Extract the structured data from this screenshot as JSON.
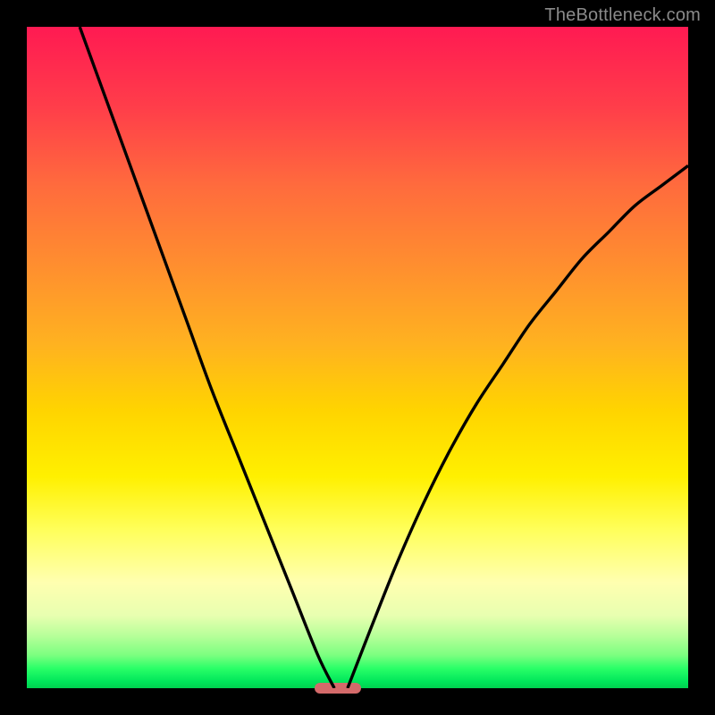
{
  "watermark": "TheBottleneck.com",
  "colors": {
    "frame": "#000000",
    "gradient_top": "#ff1a52",
    "gradient_mid": "#ffe800",
    "gradient_bottom": "#00d050",
    "curve": "#000000",
    "marker": "#d46a6a"
  },
  "chart_data": {
    "type": "line",
    "title": "",
    "xlabel": "",
    "ylabel": "",
    "xlim": [
      0,
      100
    ],
    "ylim": [
      0,
      100
    ],
    "grid": false,
    "marker_x_range": [
      43.5,
      50.5
    ],
    "series": [
      {
        "name": "left-curve",
        "x": [
          8,
          12,
          16,
          20,
          24,
          28,
          32,
          36,
          40,
          44,
          46.5
        ],
        "y": [
          100,
          89,
          78,
          67,
          56,
          45,
          35,
          25,
          15,
          5,
          0
        ]
      },
      {
        "name": "right-curve",
        "x": [
          48.5,
          52,
          56,
          60,
          64,
          68,
          72,
          76,
          80,
          84,
          88,
          92,
          96,
          100
        ],
        "y": [
          0,
          9,
          19,
          28,
          36,
          43,
          49,
          55,
          60,
          65,
          69,
          73,
          76,
          79
        ]
      }
    ]
  }
}
